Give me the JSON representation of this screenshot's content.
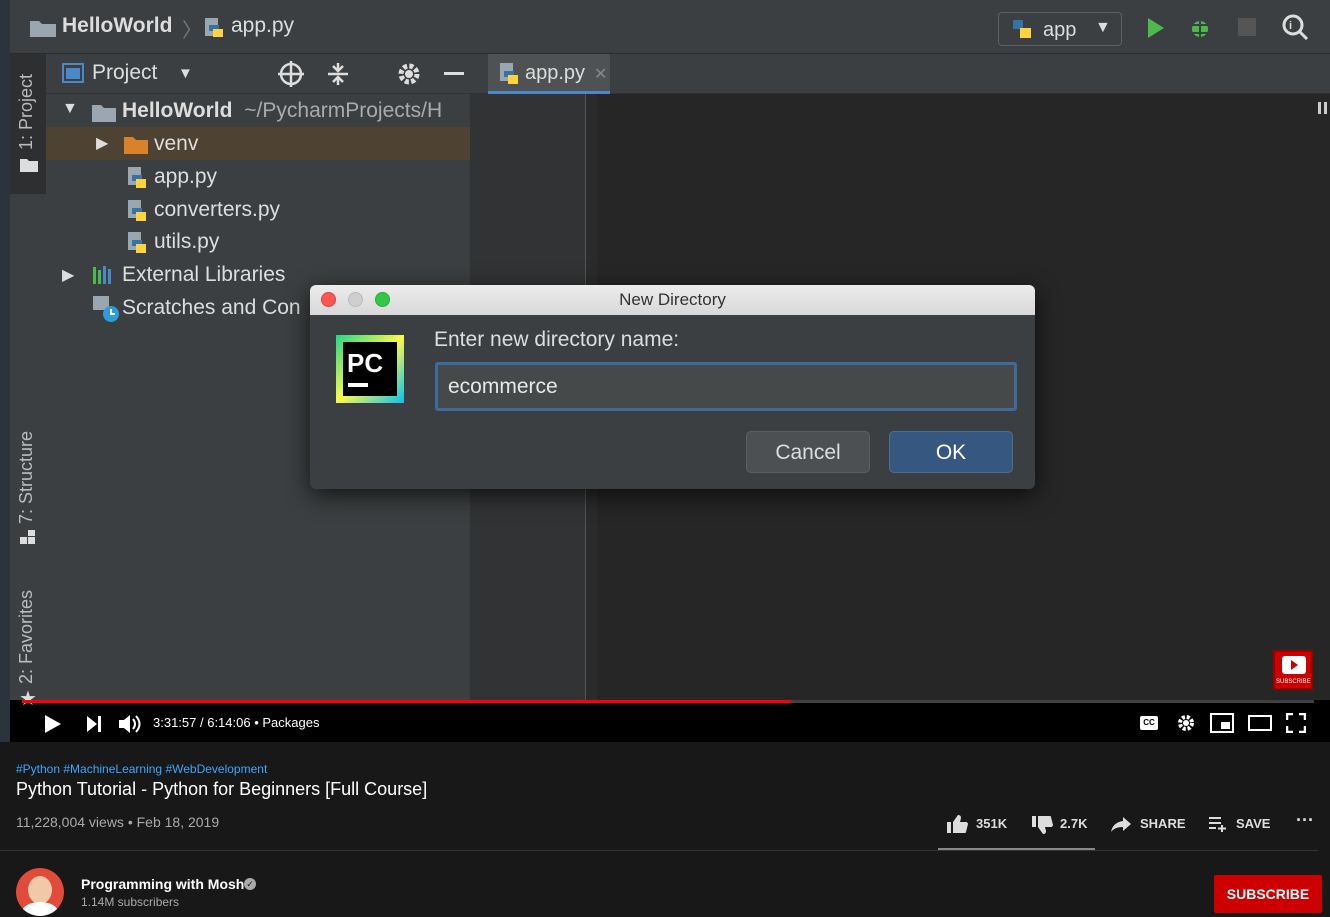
{
  "ide": {
    "breadcrumb": {
      "project": "HelloWorld",
      "file": "app.py"
    },
    "run_config": "app",
    "left_tabs": {
      "project": "1: Project",
      "structure": "7: Structure",
      "favorites": "2: Favorites"
    },
    "project_panel": {
      "title": "Project",
      "tree": {
        "root": "HelloWorld",
        "root_path": "~/PycharmProjects/H",
        "venv": "venv",
        "files": [
          "app.py",
          "converters.py",
          "utils.py"
        ],
        "external": "External Libraries",
        "scratches": "Scratches and Con"
      }
    },
    "editor_tab": "app.py"
  },
  "dialog": {
    "title": "New Directory",
    "logo_text": "PC",
    "prompt": "Enter new directory name:",
    "input_value": "ecommerce",
    "cancel": "Cancel",
    "ok": "OK"
  },
  "player": {
    "time": "3:31:57 / 6:14:06 • Packages",
    "progress": 0.595,
    "watermark": "SUBSCRIBE"
  },
  "video": {
    "hashtags": "#Python #MachineLearning #WebDevelopment",
    "title": "Python Tutorial - Python for Beginners [Full Course]",
    "meta": "11,228,004 views • Feb 18, 2019",
    "likes": "351K",
    "dislikes": "2.7K",
    "share": "SHARE",
    "save": "SAVE",
    "channel": "Programming with Mosh",
    "subscribers": "1.14M subscribers",
    "subscribe": "SUBSCRIBE"
  },
  "colors": {
    "accent_blue": "#4a88c7",
    "folder_orange": "#d9822b",
    "run_green": "#4cb94c",
    "yt_red": "#cc0000",
    "link_blue": "#3ea6ff"
  }
}
